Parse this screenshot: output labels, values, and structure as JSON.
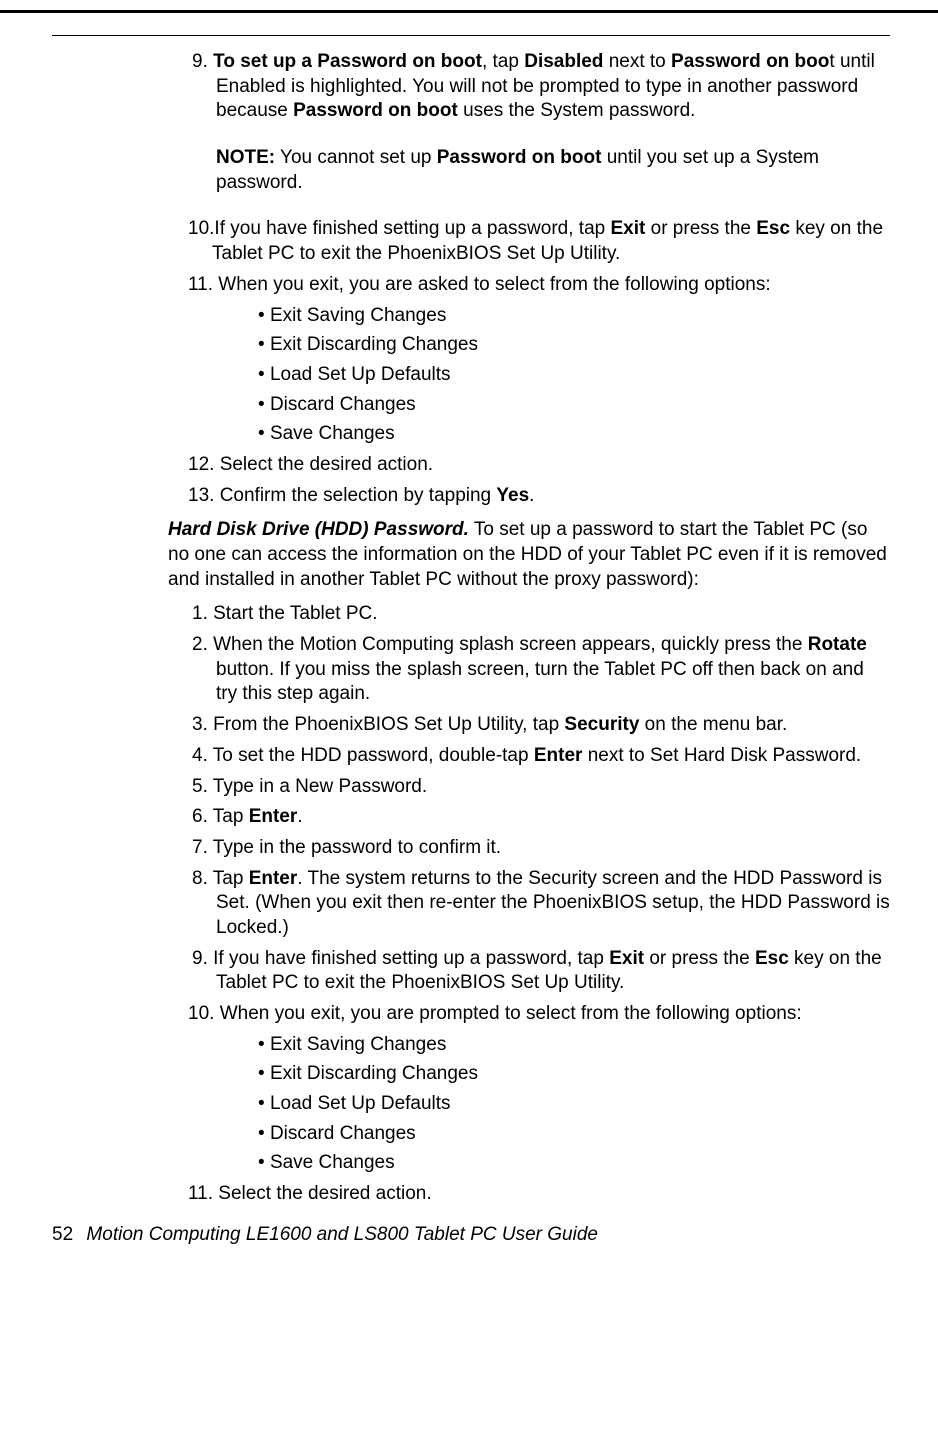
{
  "step9_full": "9. <b>To set up a Password on boot</b>, tap <b>Disabled</b> next to <b>Password on boo</b>t until Enabled is highlighted. You will not be prompted to type in another password because <b>Password on boot</b> uses the System password.",
  "note_full": "<b>NOTE:</b> You cannot set up <b>Password on boot</b> until you set up a System password.",
  "step10_full": "10.If you have finished setting up a password, tap <b>Exit</b> or press the <b>Esc</b> key on the Tablet PC to exit the PhoenixBIOS Set Up Utility.",
  "step11_full": "11. When you exit, you are asked to select from the following options:",
  "bullets1": [
    "Exit Saving Changes",
    "Exit Discarding Changes",
    "Load Set Up Defaults",
    "Discard Changes",
    "Save Changes"
  ],
  "step12": "12. Select the desired action.",
  "step13_full": "13. Confirm the selection by tapping <b>Yes</b>.",
  "hdd_para_full": "<b><i>Hard Disk Drive (HDD) Password.</i></b> To set up a password to start the Tablet PC (so no one can access the information on the HDD of your Tablet PC even if it is removed and installed in another Tablet PC without the proxy password):",
  "hdd_step1": "1. Start the Tablet PC.",
  "hdd_step2_full": "2. When the Motion Computing splash screen appears, quickly press the <b>Rotate</b> button. If you miss the splash screen, turn the Tablet PC off then back on and try this step again.",
  "hdd_step3_full": "3. From the PhoenixBIOS Set Up Utility, tap <b>Security</b> on the menu bar.",
  "hdd_step4_full": "4. To set the HDD password, double-tap <b>Enter</b> next to Set Hard Disk Password.",
  "hdd_step5": "5. Type in a New Password.",
  "hdd_step6_full": "6. Tap <b>Enter</b>.",
  "hdd_step7": "7. Type in the password to confirm it.",
  "hdd_step8_full": "8. Tap <b>Enter</b>. The system returns to the Security screen and the HDD Password is Set. (When you exit then re-enter the PhoenixBIOS setup, the HDD Password is Locked.)",
  "hdd_step9_full": "9. If you have finished setting up a password, tap <b>Exit</b> or press the <b>Esc</b> key on the Tablet PC to exit the PhoenixBIOS Set Up Utility.",
  "hdd_step10_full": "10. When you exit, you are prompted to select from the following options:",
  "bullets2": [
    "Exit Saving Changes",
    "Exit Discarding Changes",
    "Load Set Up Defaults",
    "Discard Changes",
    "Save Changes"
  ],
  "hdd_step11": "11. Select the desired action.",
  "footer_page": "52",
  "footer_text": "Motion Computing LE1600 and LS800 Tablet PC User Guide"
}
